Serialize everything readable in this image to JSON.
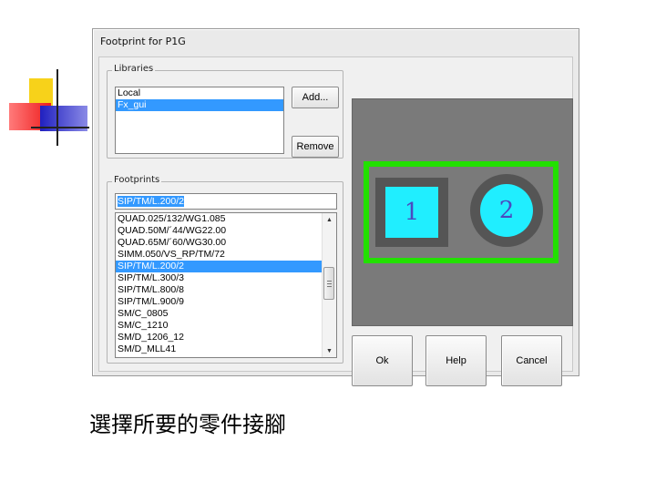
{
  "dialog": {
    "title": "Footprint for P1G"
  },
  "libraries": {
    "label": "Libraries",
    "items": [
      {
        "label": "Local",
        "selected": false
      },
      {
        "label": "Fx_gui",
        "selected": true
      }
    ],
    "add_label": "Add...",
    "remove_label": "Remove"
  },
  "footprints": {
    "label": "Footprints",
    "filter_value": "SIP/TM/L.200/2",
    "items": [
      {
        "label": "QUAD.025/132/WG1.085",
        "selected": false
      },
      {
        "label": "QUAD.50M/´44/WG22.00",
        "selected": false
      },
      {
        "label": "QUAD.65M/´60/WG30.00",
        "selected": false
      },
      {
        "label": "SIMM.050/VS_RP/TM/72",
        "selected": false
      },
      {
        "label": "SIP/TM/L.200/2",
        "selected": true
      },
      {
        "label": "SIP/TM/L.300/3",
        "selected": false
      },
      {
        "label": "SIP/TM/L.800/8",
        "selected": false
      },
      {
        "label": "SIP/TM/L.900/9",
        "selected": false
      },
      {
        "label": "SM/C_0805",
        "selected": false
      },
      {
        "label": "SM/C_1210",
        "selected": false
      },
      {
        "label": "SM/D_1206_12",
        "selected": false
      },
      {
        "label": "SM/D_MLL41",
        "selected": false
      }
    ],
    "scroll_up_icon": "▲",
    "scroll_down_icon": "▼"
  },
  "preview": {
    "pad1_label": "1",
    "pad2_label": "2",
    "colors": {
      "background": "#7a7a7a",
      "outline": "#22e000",
      "pad": "#20eeff",
      "pad_ring": "#555555"
    }
  },
  "buttons": {
    "ok": "Ok",
    "help": "Help",
    "cancel": "Cancel"
  },
  "caption": "選擇所要的零件接腳"
}
